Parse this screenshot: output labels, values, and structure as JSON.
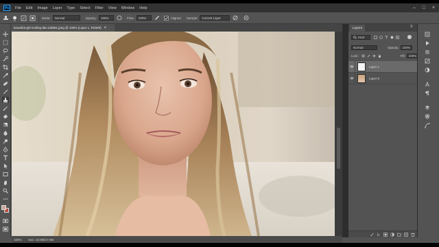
{
  "menubar": {
    "logo": "Ps",
    "items": [
      "File",
      "Edit",
      "Image",
      "Layer",
      "Type",
      "Select",
      "Filter",
      "View",
      "Window",
      "Help"
    ],
    "minimize": "–",
    "maximize": "□",
    "close": "×"
  },
  "options": {
    "mode_label": "Mode:",
    "mode_value": "Normal",
    "opacity_label": "Opacity:",
    "opacity_value": "100%",
    "flow_label": "Flow:",
    "flow_value": "100%",
    "aligned_label": "Aligned",
    "sample_label": "Sample:",
    "sample_value": "Current Layer"
  },
  "document": {
    "tab_title": "beautiful-girl-smiling-dla-128881.jpeg @ 100% (Layer 1, RGB/8)",
    "close": "×",
    "zoom": "100%",
    "doc_size": "Doc: 10.9M/17.9M"
  },
  "layers_panel": {
    "tab_label": "Layers",
    "kind_value": "Kind",
    "blend_mode": "Normal",
    "opacity_label": "Opacity:",
    "opacity_value": "100%",
    "lock_label": "Lock:",
    "fill_label": "Fill:",
    "fill_value": "100%",
    "layers": [
      {
        "name": "Layer 1",
        "selected": true
      },
      {
        "name": "Layer 0",
        "selected": false
      }
    ]
  },
  "colors": {
    "app_bg": "#535353",
    "menubar_bg": "#323232",
    "panel_dark": "#2d2d2d",
    "selected_layer": "#6a6a6a",
    "foreground_swatch": "#c9a896",
    "background_swatch": "#b84b3e"
  },
  "icons": {
    "toolbar": [
      "move-icon",
      "marquee-icon",
      "lasso-icon",
      "quick-select-icon",
      "crop-icon",
      "eyedropper-icon",
      "healing-brush-icon",
      "brush-icon",
      "clone-stamp-icon",
      "history-brush-icon",
      "eraser-icon",
      "gradient-icon",
      "blur-icon",
      "dodge-icon",
      "pen-icon",
      "type-icon",
      "path-select-icon",
      "rectangle-icon",
      "hand-icon",
      "zoom-icon"
    ],
    "right_strip": [
      "history-icon",
      "play-icon",
      "properties-icon",
      "brush-settings-icon",
      "paragraph-icon",
      "character-icon",
      "layers-icon"
    ]
  }
}
